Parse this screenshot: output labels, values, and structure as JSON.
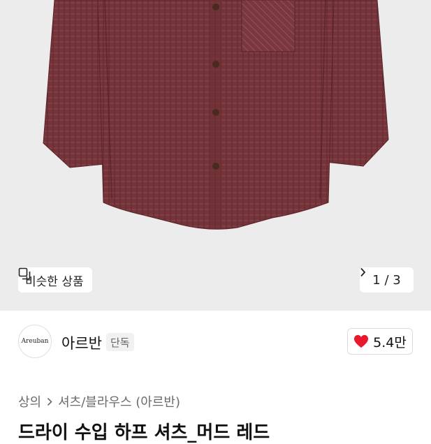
{
  "hero": {
    "similar_label": "비슷한 상품",
    "counter": "1 / 3",
    "shirt_color": "#74343a"
  },
  "brand": {
    "logo_text": "Areuban",
    "name": "아르반",
    "badge": "단독",
    "likes": "5.4만"
  },
  "breadcrumb": {
    "level1": "상의",
    "level2": "셔츠/블라우스 (아르반)"
  },
  "product": {
    "title": "드라이 수입 하프 셔츠_머드 레드"
  },
  "colors": {
    "heart": "#e8192c",
    "hero_bg": "#ececec"
  }
}
